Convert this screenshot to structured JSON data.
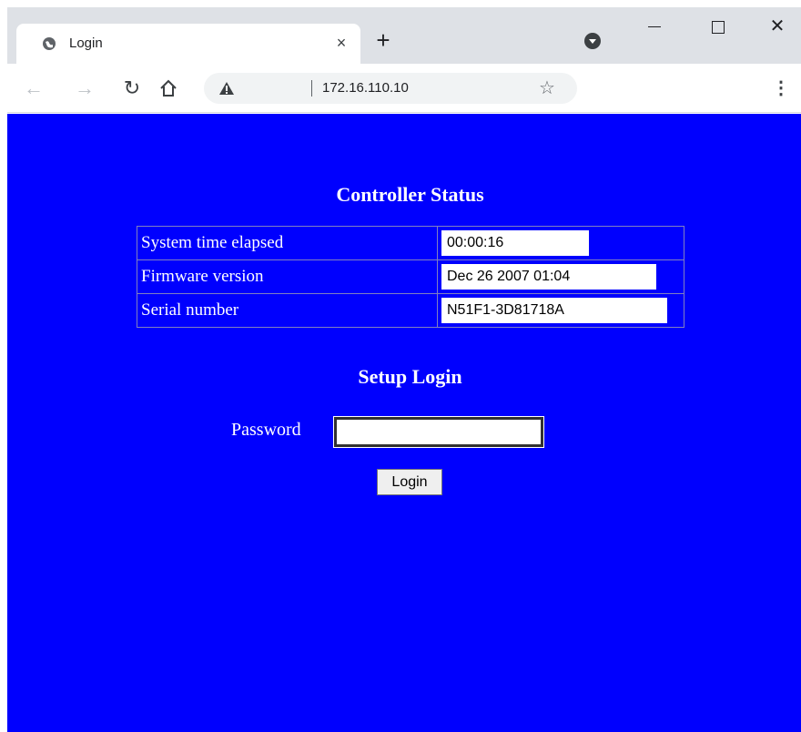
{
  "browser": {
    "tab_title": "Login",
    "tab_close": "×",
    "new_tab": "+",
    "url": "172.16.110.10",
    "icons": [
      "globe-icon",
      "close-icon",
      "plus-icon",
      "tab-search-icon",
      "minimize-icon",
      "maximize-icon",
      "close-window-icon",
      "back-icon",
      "forward-icon",
      "reload-icon",
      "home-icon",
      "warning-icon",
      "star-icon",
      "menu-icon"
    ]
  },
  "page": {
    "status_heading": "Controller Status",
    "rows": [
      {
        "label": "System time elapsed",
        "value": "00:00:16"
      },
      {
        "label": "Firmware version",
        "value": "Dec 26 2007 01:04"
      },
      {
        "label": "Serial number",
        "value": "N51F1-3D81718A"
      }
    ],
    "login_heading": "Setup Login",
    "password_label": "Password",
    "password_value": "",
    "login_button": "Login",
    "background_color": "#0000fe"
  }
}
